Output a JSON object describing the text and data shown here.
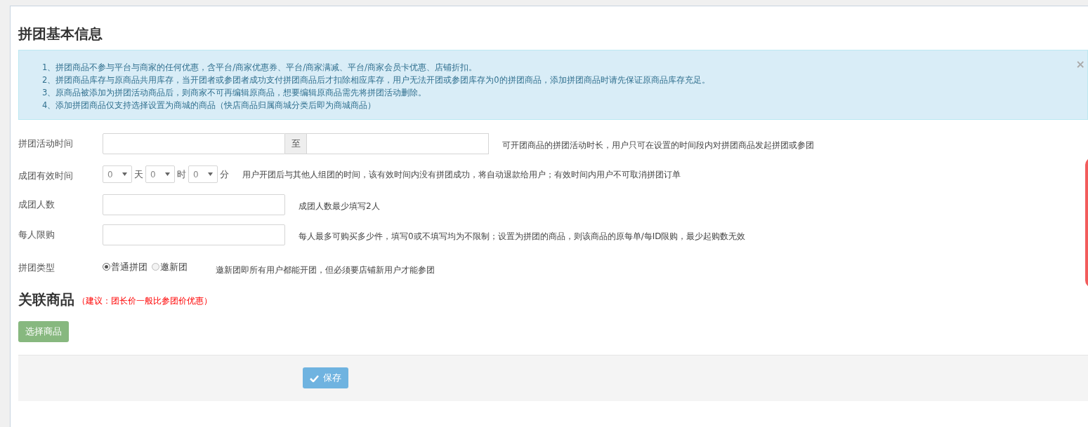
{
  "title": "拼团基本信息",
  "notice": {
    "lines": [
      "1、拼团商品不参与平台与商家的任何优惠，含平台/商家优惠券、平台/商家满减、平台/商家会员卡优惠、店铺折扣。",
      "2、拼团商品库存与原商品共用库存，当开团者或参团者成功支付拼团商品后才扣除相应库存，用户无法开团或参团库存为0的拼团商品，添加拼团商品时请先保证原商品库存充足。",
      "3、原商品被添加为拼团活动商品后，则商家不可再编辑原商品，想要编辑原商品需先将拼团活动删除。",
      "4、添加拼团商品仅支持选择设置为商城的商品（快店商品归属商城分类后即为商城商品）"
    ],
    "close": "×"
  },
  "fields": [
    {
      "kind": "range",
      "label": "拼团活动时间",
      "separator": "至",
      "help": "可开团商品的拼团活动时长，用户只可在设置的时间段内对拼团商品发起拼团或参团"
    },
    {
      "kind": "duration",
      "label": "成团有效时间",
      "parts": [
        {
          "value": "0",
          "unit": "天"
        },
        {
          "value": "0",
          "unit": "时"
        },
        {
          "value": "0",
          "unit": "分"
        }
      ],
      "help": "用户开团后与其他人组团的时间，该有效时间内没有拼团成功，将自动退款给用户；有效时间内用户不可取消拼团订单"
    },
    {
      "kind": "text",
      "label": "成团人数",
      "help": "成团人数最少填写2人"
    },
    {
      "kind": "text",
      "label": "每人限购",
      "help": "每人最多可购买多少件，填写0或不填写均为不限制；设置为拼团的商品，则该商品的原每单/每ID限购，最少起购数无效"
    },
    {
      "kind": "radio",
      "label": "拼团类型",
      "options": [
        {
          "label": "普通拼团",
          "selected": true
        },
        {
          "label": "邀新团",
          "selected": false
        }
      ],
      "help": "邀新团即所有用户都能开团，但必须要店铺新用户才能参团"
    }
  ],
  "products": {
    "title": "关联商品",
    "note": "（建议：团长价一般比参团价优惠）",
    "button": "选择商品"
  },
  "save_button": "保存"
}
